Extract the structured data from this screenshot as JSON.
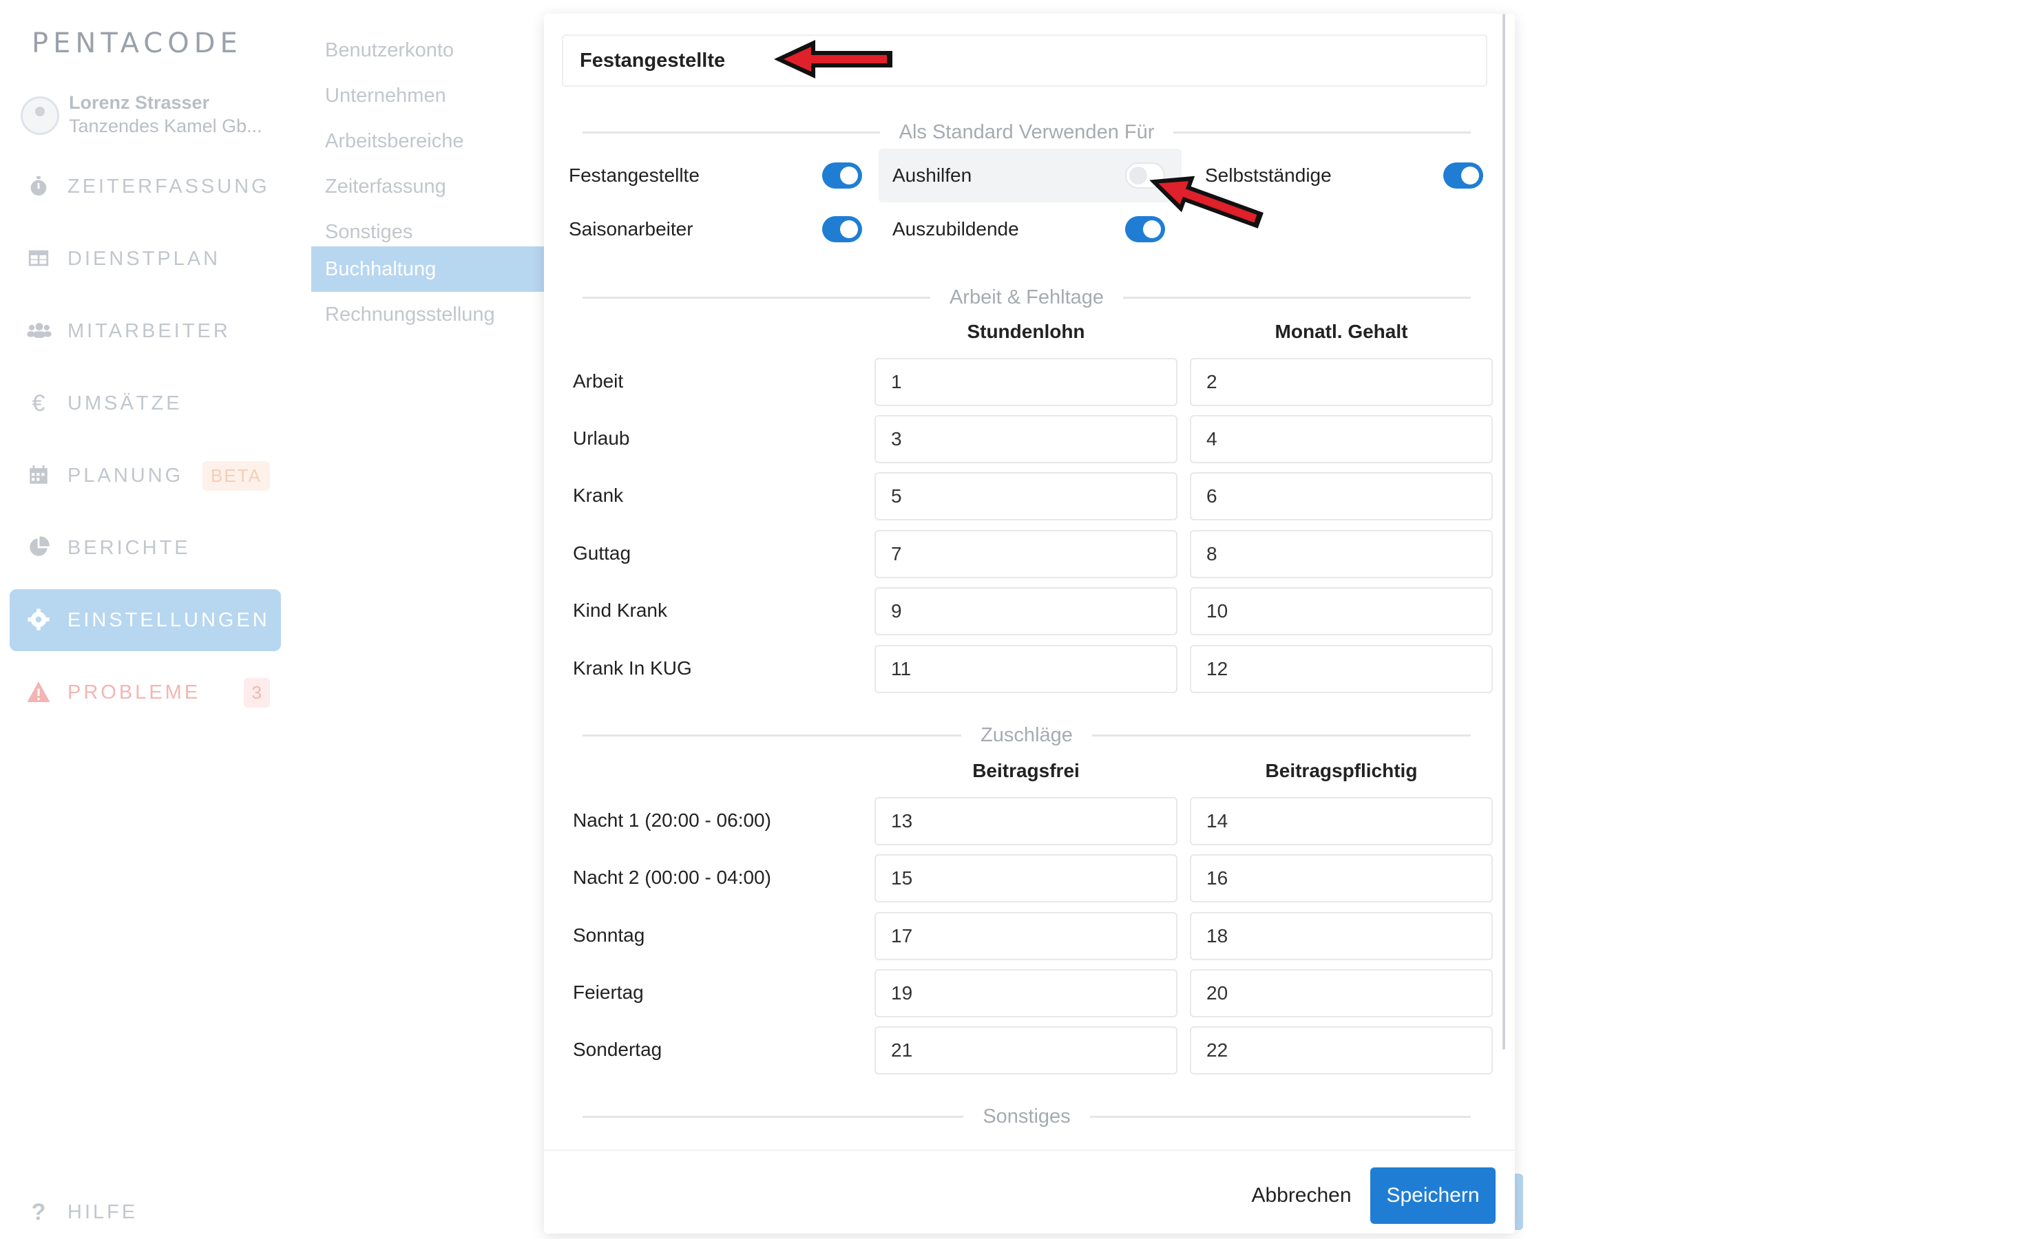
{
  "app": {
    "logo_text": "PENTACODE"
  },
  "user": {
    "name": "Lorenz Strasser",
    "company": "Tanzendes Kamel Gb..."
  },
  "nav": [
    {
      "label": "ZEITERFASSUNG",
      "icon": "stopwatch-icon"
    },
    {
      "label": "DIENSTPLAN",
      "icon": "table-icon"
    },
    {
      "label": "MITARBEITER",
      "icon": "users-icon"
    },
    {
      "label": "UMSÄTZE",
      "icon": "euro-icon"
    },
    {
      "label": "PLANUNG",
      "icon": "calendar-icon",
      "badge": "BETA"
    },
    {
      "label": "BERICHTE",
      "icon": "pie-chart-icon"
    },
    {
      "label": "EINSTELLUNGEN",
      "icon": "gear-icon",
      "active": true
    },
    {
      "label": "PROBLEME",
      "icon": "warning-icon",
      "badge": "3"
    },
    {
      "label": "HILFE",
      "icon": "question-icon"
    }
  ],
  "submenu": [
    {
      "label": "Benutzerkonto"
    },
    {
      "label": "Unternehmen"
    },
    {
      "label": "Arbeitsbereiche"
    },
    {
      "label": "Zeiterfassung"
    },
    {
      "label": "Sonstiges"
    },
    {
      "label": "Buchhaltung",
      "active": true
    },
    {
      "label": "Rechnungsstellung"
    }
  ],
  "modal": {
    "name_value": "Festangestellte",
    "sections": {
      "default_for": "Als Standard Verwenden Für",
      "work_absence": "Arbeit & Fehltage",
      "surcharges": "Zuschläge",
      "misc": "Sonstiges"
    },
    "toggles": [
      {
        "label": "Festangestellte",
        "on": true
      },
      {
        "label": "Aushilfen",
        "on": false
      },
      {
        "label": "Selbstständige",
        "on": true
      },
      {
        "label": "Saisonarbeiter",
        "on": true
      },
      {
        "label": "Auszubildende",
        "on": true
      }
    ],
    "work_table": {
      "headers": [
        "Stundenlohn",
        "Monatl. Gehalt"
      ],
      "rows": [
        {
          "label": "Arbeit",
          "values": [
            "1",
            "2"
          ]
        },
        {
          "label": "Urlaub",
          "values": [
            "3",
            "4"
          ]
        },
        {
          "label": "Krank",
          "values": [
            "5",
            "6"
          ]
        },
        {
          "label": "Guttag",
          "values": [
            "7",
            "8"
          ]
        },
        {
          "label": "Kind Krank",
          "values": [
            "9",
            "10"
          ]
        },
        {
          "label": "Krank In KUG",
          "values": [
            "11",
            "12"
          ]
        }
      ]
    },
    "surcharge_table": {
      "headers": [
        "Beitragsfrei",
        "Beitragspflichtig"
      ],
      "rows": [
        {
          "label": "Nacht 1 (20:00 - 06:00)",
          "values": [
            "13",
            "14"
          ]
        },
        {
          "label": "Nacht 2 (00:00 - 04:00)",
          "values": [
            "15",
            "16"
          ]
        },
        {
          "label": "Sonntag",
          "values": [
            "17",
            "18"
          ]
        },
        {
          "label": "Feiertag",
          "values": [
            "19",
            "20"
          ]
        },
        {
          "label": "Sondertag",
          "values": [
            "21",
            "22"
          ]
        }
      ]
    },
    "buttons": {
      "cancel": "Abbrechen",
      "save": "Speichern"
    }
  },
  "colors": {
    "accent": "#1f7ed4",
    "active_nav": "#b7d6f0",
    "arrow": "#e0202a"
  }
}
